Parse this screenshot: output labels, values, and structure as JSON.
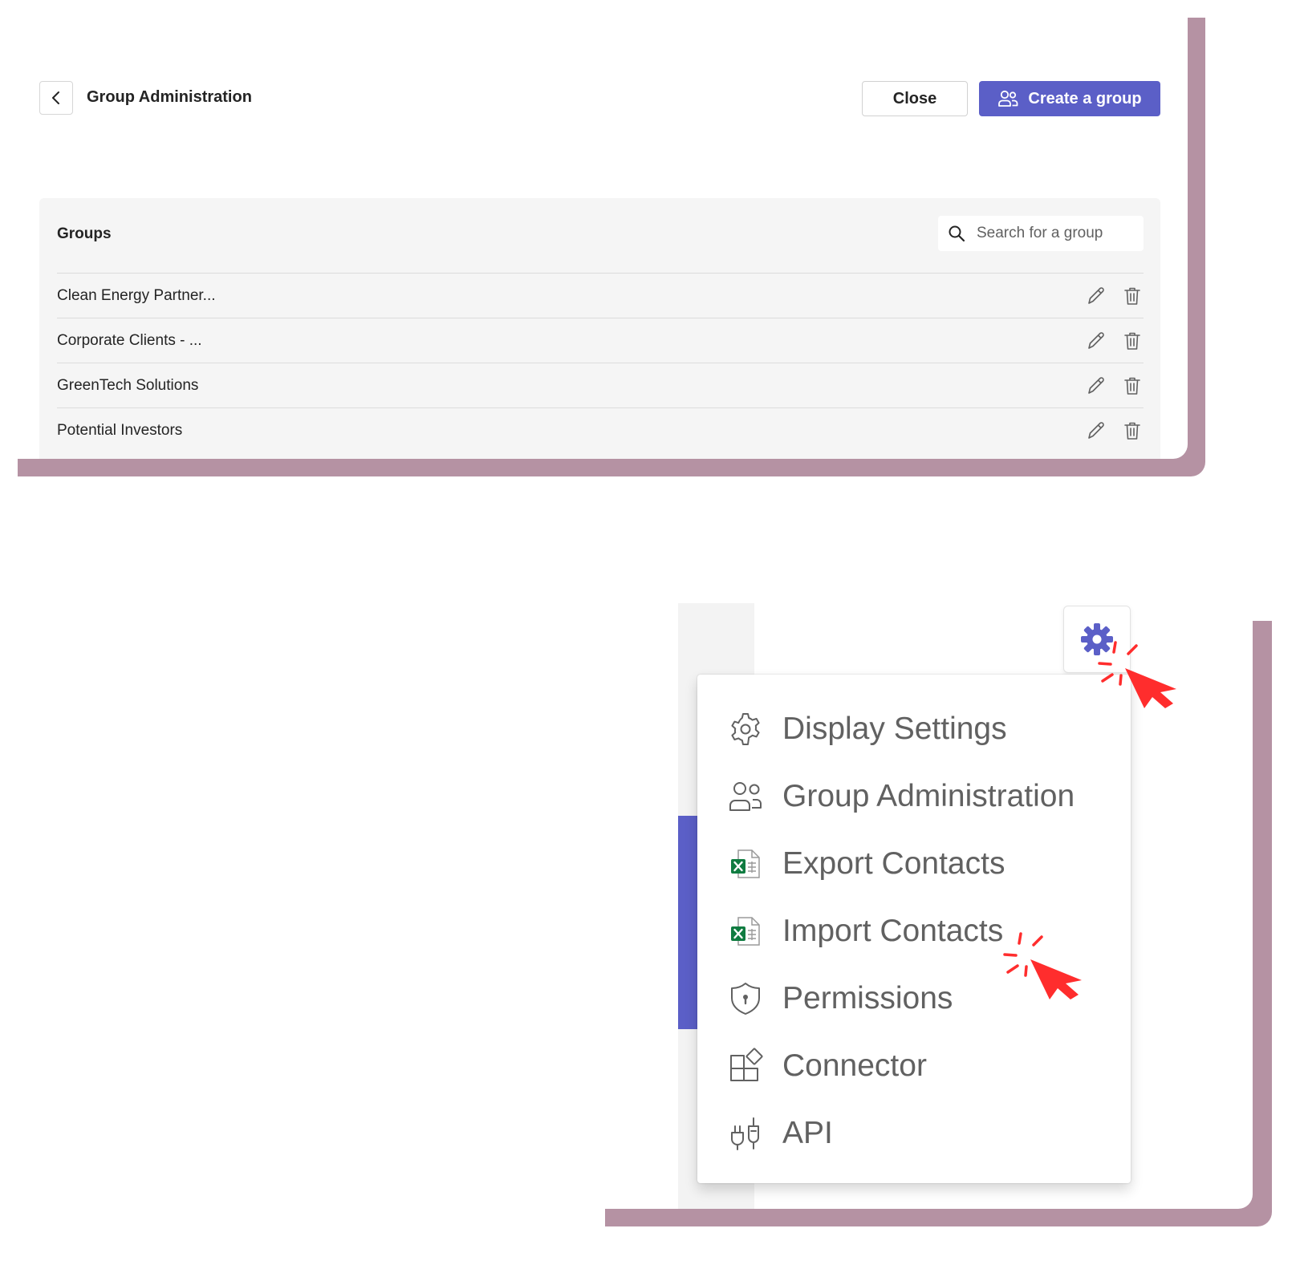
{
  "header": {
    "title": "Group Administration",
    "close_label": "Close",
    "create_label": "Create a group"
  },
  "groups": {
    "title": "Groups",
    "search_placeholder": "Search for a group",
    "items": [
      {
        "name": "Clean Energy Partner..."
      },
      {
        "name": "Corporate Clients - ..."
      },
      {
        "name": "GreenTech Solutions"
      },
      {
        "name": "Potential Investors"
      }
    ]
  },
  "settings_menu": {
    "items": [
      {
        "label": "Display Settings",
        "icon": "gear-icon"
      },
      {
        "label": "Group Administration",
        "icon": "people-icon"
      },
      {
        "label": "Export Contacts",
        "icon": "excel-icon"
      },
      {
        "label": "Import Contacts",
        "icon": "excel-icon"
      },
      {
        "label": "Permissions",
        "icon": "shield-lock-icon"
      },
      {
        "label": "Connector",
        "icon": "apps-add-icon"
      },
      {
        "label": "API",
        "icon": "plug-icon"
      }
    ]
  },
  "colors": {
    "brand": "#5b5fc7",
    "shadow": "#b592a3",
    "cursor": "#ff2d2d",
    "excel": "#107c41"
  }
}
